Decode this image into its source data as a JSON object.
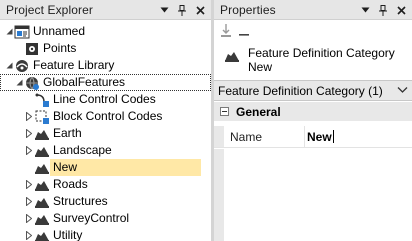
{
  "explorer": {
    "title": "Project Explorer",
    "items": [
      {
        "label": "Unnamed",
        "icon": "project-icon",
        "arrow": "expanded"
      },
      {
        "label": "Points",
        "icon": "points-icon",
        "arrow": "none"
      },
      {
        "label": "Feature Library",
        "icon": "feature-library-icon",
        "arrow": "expanded"
      },
      {
        "label": "GlobalFeatures",
        "icon": "global-features-icon",
        "arrow": "expanded"
      },
      {
        "label": "Line Control Codes",
        "icon": "line-control-codes-icon",
        "arrow": "none"
      },
      {
        "label": "Block Control Codes",
        "icon": "block-control-codes-icon",
        "arrow": "collapsed"
      },
      {
        "label": "Earth",
        "icon": "category-icon",
        "arrow": "collapsed"
      },
      {
        "label": "Landscape",
        "icon": "category-icon",
        "arrow": "collapsed"
      },
      {
        "label": "New",
        "icon": "category-icon",
        "arrow": "none"
      },
      {
        "label": "Roads",
        "icon": "category-icon",
        "arrow": "collapsed"
      },
      {
        "label": "Structures",
        "icon": "category-icon",
        "arrow": "collapsed"
      },
      {
        "label": "SurveyControl",
        "icon": "category-icon",
        "arrow": "collapsed"
      },
      {
        "label": "Utility",
        "icon": "category-icon",
        "arrow": "collapsed"
      }
    ]
  },
  "properties": {
    "title": "Properties",
    "header_line1": "Feature Definition Category",
    "header_line2": "New",
    "selector": "Feature Definition Category (1)",
    "section": "General",
    "name_label": "Name",
    "name_value": "New"
  },
  "colors": {
    "titlebar": "#e6e6e6",
    "selection": "#ffe8a6",
    "category_icon": "#3a3a3a",
    "accent_blue": "#2b7bd0"
  }
}
